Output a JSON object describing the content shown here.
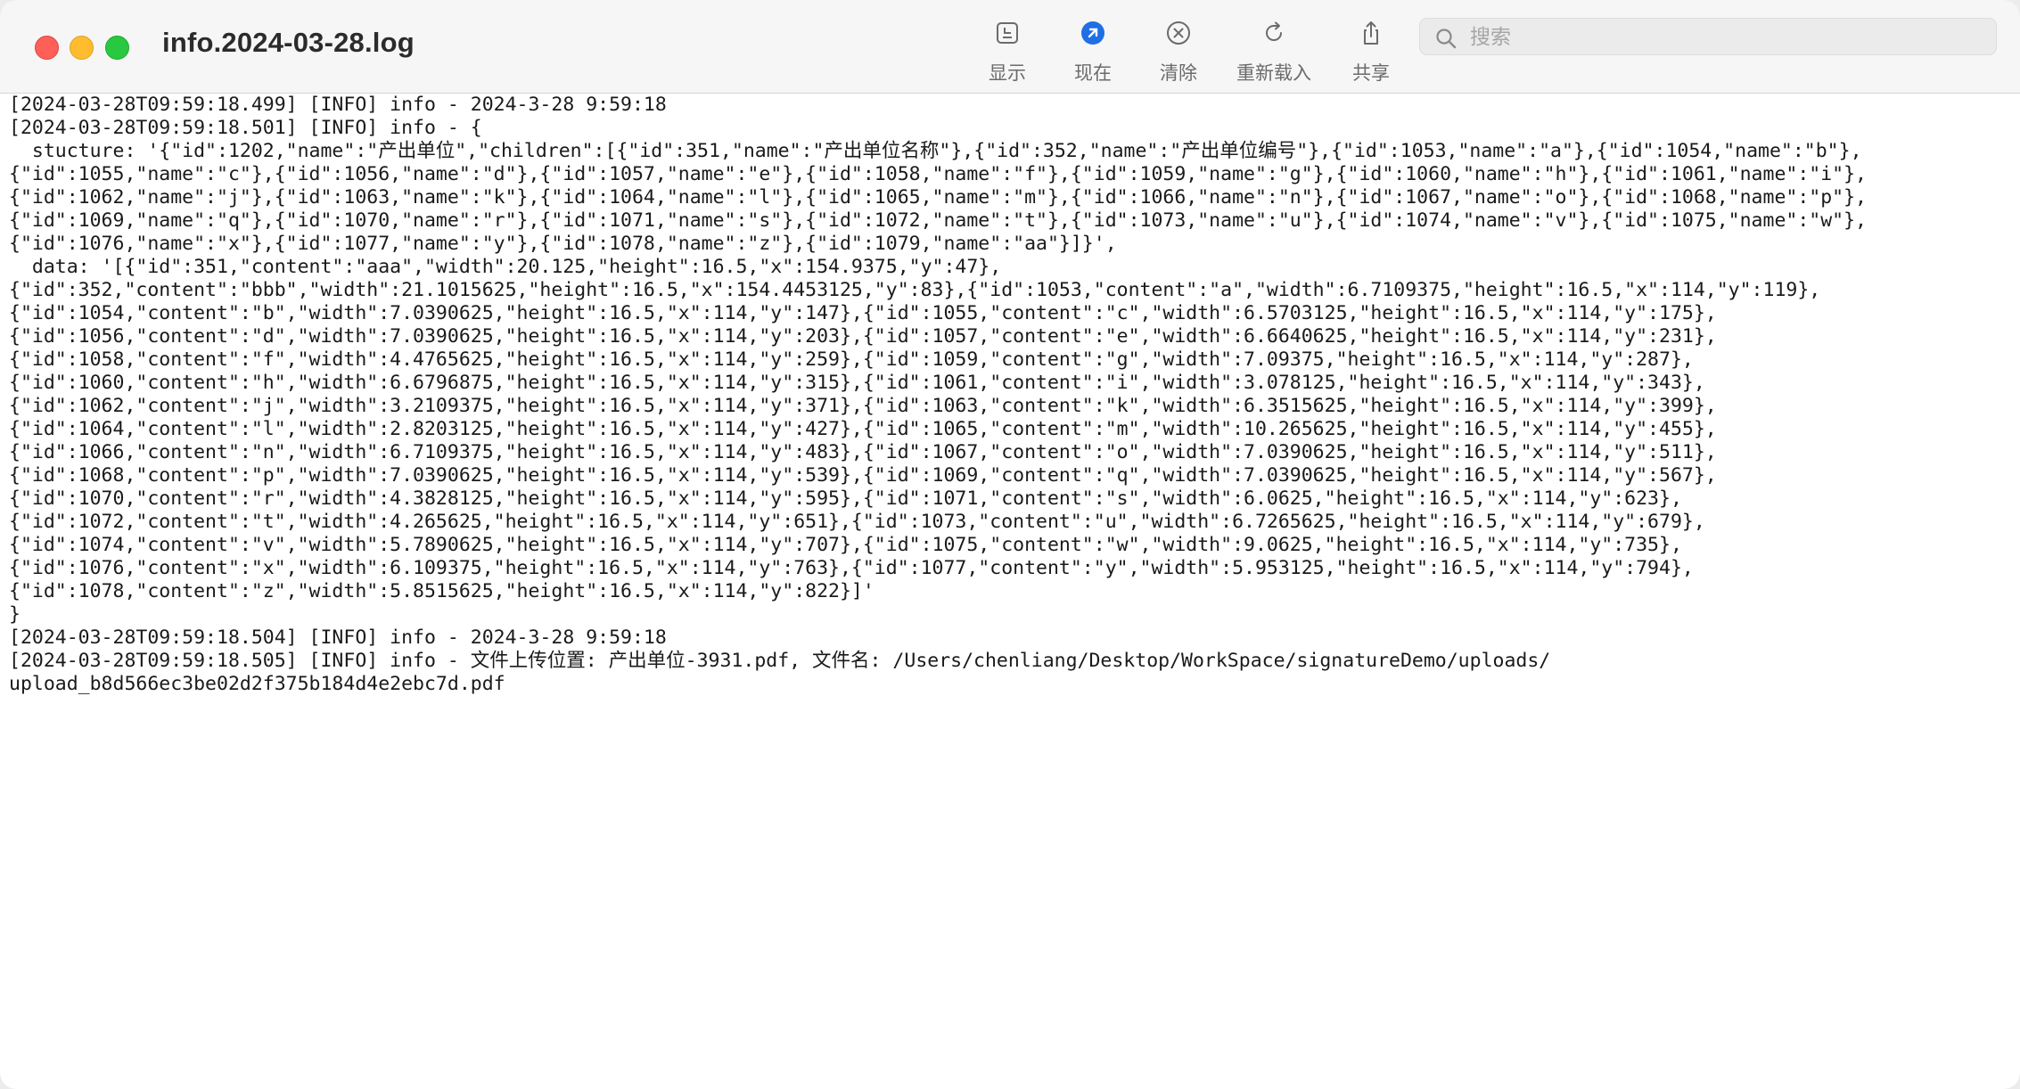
{
  "window": {
    "title": "info.2024-03-28.log"
  },
  "toolbar": {
    "items": [
      {
        "label": "显示",
        "icon": "sidebar-display-icon"
      },
      {
        "label": "现在",
        "icon": "jump-to-now-icon"
      },
      {
        "label": "清除",
        "icon": "clear-icon"
      },
      {
        "label": "重新载入",
        "icon": "reload-icon"
      },
      {
        "label": "共享",
        "icon": "share-icon"
      }
    ],
    "accent_color": "#1f6fe5"
  },
  "search": {
    "placeholder": "搜索",
    "value": ""
  },
  "log": {
    "lines": [
      "[2024-03-28T09:59:18.499] [INFO] info - 2024-3-28 9:59:18",
      "[2024-03-28T09:59:18.501] [INFO] info - {",
      "  stucture: '{\"id\":1202,\"name\":\"产出单位\",\"children\":[{\"id\":351,\"name\":\"产出单位名称\"},{\"id\":352,\"name\":\"产出单位编号\"},{\"id\":1053,\"name\":\"a\"},{\"id\":1054,\"name\":\"b\"},",
      "{\"id\":1055,\"name\":\"c\"},{\"id\":1056,\"name\":\"d\"},{\"id\":1057,\"name\":\"e\"},{\"id\":1058,\"name\":\"f\"},{\"id\":1059,\"name\":\"g\"},{\"id\":1060,\"name\":\"h\"},{\"id\":1061,\"name\":\"i\"},",
      "{\"id\":1062,\"name\":\"j\"},{\"id\":1063,\"name\":\"k\"},{\"id\":1064,\"name\":\"l\"},{\"id\":1065,\"name\":\"m\"},{\"id\":1066,\"name\":\"n\"},{\"id\":1067,\"name\":\"o\"},{\"id\":1068,\"name\":\"p\"},",
      "{\"id\":1069,\"name\":\"q\"},{\"id\":1070,\"name\":\"r\"},{\"id\":1071,\"name\":\"s\"},{\"id\":1072,\"name\":\"t\"},{\"id\":1073,\"name\":\"u\"},{\"id\":1074,\"name\":\"v\"},{\"id\":1075,\"name\":\"w\"},",
      "{\"id\":1076,\"name\":\"x\"},{\"id\":1077,\"name\":\"y\"},{\"id\":1078,\"name\":\"z\"},{\"id\":1079,\"name\":\"aa\"}]}',",
      "  data: '[{\"id\":351,\"content\":\"aaa\",\"width\":20.125,\"height\":16.5,\"x\":154.9375,\"y\":47},",
      "{\"id\":352,\"content\":\"bbb\",\"width\":21.1015625,\"height\":16.5,\"x\":154.4453125,\"y\":83},{\"id\":1053,\"content\":\"a\",\"width\":6.7109375,\"height\":16.5,\"x\":114,\"y\":119},",
      "{\"id\":1054,\"content\":\"b\",\"width\":7.0390625,\"height\":16.5,\"x\":114,\"y\":147},{\"id\":1055,\"content\":\"c\",\"width\":6.5703125,\"height\":16.5,\"x\":114,\"y\":175},",
      "{\"id\":1056,\"content\":\"d\",\"width\":7.0390625,\"height\":16.5,\"x\":114,\"y\":203},{\"id\":1057,\"content\":\"e\",\"width\":6.6640625,\"height\":16.5,\"x\":114,\"y\":231},",
      "{\"id\":1058,\"content\":\"f\",\"width\":4.4765625,\"height\":16.5,\"x\":114,\"y\":259},{\"id\":1059,\"content\":\"g\",\"width\":7.09375,\"height\":16.5,\"x\":114,\"y\":287},",
      "{\"id\":1060,\"content\":\"h\",\"width\":6.6796875,\"height\":16.5,\"x\":114,\"y\":315},{\"id\":1061,\"content\":\"i\",\"width\":3.078125,\"height\":16.5,\"x\":114,\"y\":343},",
      "{\"id\":1062,\"content\":\"j\",\"width\":3.2109375,\"height\":16.5,\"x\":114,\"y\":371},{\"id\":1063,\"content\":\"k\",\"width\":6.3515625,\"height\":16.5,\"x\":114,\"y\":399},",
      "{\"id\":1064,\"content\":\"l\",\"width\":2.8203125,\"height\":16.5,\"x\":114,\"y\":427},{\"id\":1065,\"content\":\"m\",\"width\":10.265625,\"height\":16.5,\"x\":114,\"y\":455},",
      "{\"id\":1066,\"content\":\"n\",\"width\":6.7109375,\"height\":16.5,\"x\":114,\"y\":483},{\"id\":1067,\"content\":\"o\",\"width\":7.0390625,\"height\":16.5,\"x\":114,\"y\":511},",
      "{\"id\":1068,\"content\":\"p\",\"width\":7.0390625,\"height\":16.5,\"x\":114,\"y\":539},{\"id\":1069,\"content\":\"q\",\"width\":7.0390625,\"height\":16.5,\"x\":114,\"y\":567},",
      "{\"id\":1070,\"content\":\"r\",\"width\":4.3828125,\"height\":16.5,\"x\":114,\"y\":595},{\"id\":1071,\"content\":\"s\",\"width\":6.0625,\"height\":16.5,\"x\":114,\"y\":623},",
      "{\"id\":1072,\"content\":\"t\",\"width\":4.265625,\"height\":16.5,\"x\":114,\"y\":651},{\"id\":1073,\"content\":\"u\",\"width\":6.7265625,\"height\":16.5,\"x\":114,\"y\":679},",
      "{\"id\":1074,\"content\":\"v\",\"width\":5.7890625,\"height\":16.5,\"x\":114,\"y\":707},{\"id\":1075,\"content\":\"w\",\"width\":9.0625,\"height\":16.5,\"x\":114,\"y\":735},",
      "{\"id\":1076,\"content\":\"x\",\"width\":6.109375,\"height\":16.5,\"x\":114,\"y\":763},{\"id\":1077,\"content\":\"y\",\"width\":5.953125,\"height\":16.5,\"x\":114,\"y\":794},",
      "{\"id\":1078,\"content\":\"z\",\"width\":5.8515625,\"height\":16.5,\"x\":114,\"y\":822}]'",
      "}",
      "[2024-03-28T09:59:18.504] [INFO] info - 2024-3-28 9:59:18",
      "[2024-03-28T09:59:18.505] [INFO] info - 文件上传位置: 产出单位-3931.pdf, 文件名: /Users/chenliang/Desktop/WorkSpace/signatureDemo/uploads/",
      "upload_b8d566ec3be02d2f375b184d4e2ebc7d.pdf"
    ]
  }
}
